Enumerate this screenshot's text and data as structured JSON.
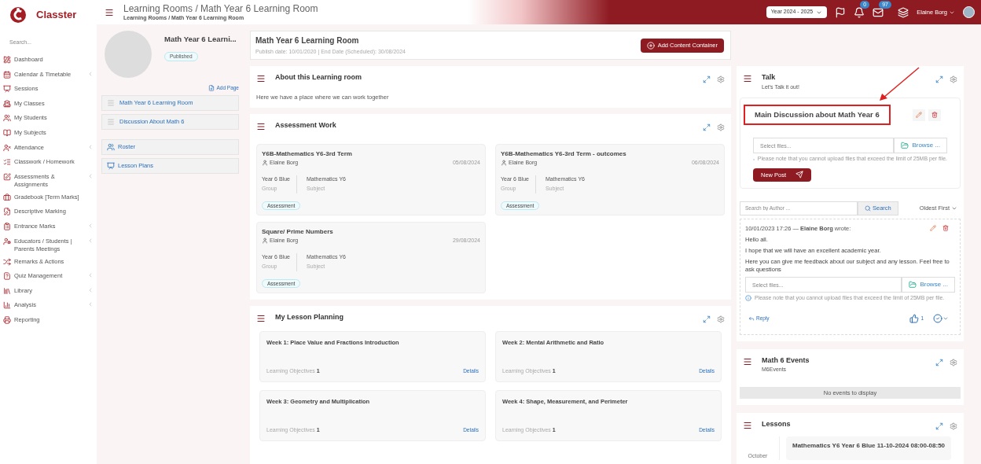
{
  "brand": {
    "name": "Classter"
  },
  "sidebar": {
    "search_placeholder": "Search...",
    "items": [
      {
        "label": "Dashboard",
        "has_submenu": false
      },
      {
        "label": "Calendar & Timetable",
        "has_submenu": true
      },
      {
        "label": "Sessions",
        "has_submenu": false
      },
      {
        "label": "My Classes",
        "has_submenu": false
      },
      {
        "label": "My Students",
        "has_submenu": false
      },
      {
        "label": "My Subjects",
        "has_submenu": false
      },
      {
        "label": "Attendance",
        "has_submenu": true
      },
      {
        "label": "Classwork / Homework",
        "has_submenu": false
      },
      {
        "label": "Assessments & Assignments",
        "has_submenu": true
      },
      {
        "label": "Gradebook [Term Marks]",
        "has_submenu": false
      },
      {
        "label": "Descriptive Marking",
        "has_submenu": false
      },
      {
        "label": "Entrance Marks",
        "has_submenu": true
      },
      {
        "label": "Educators / Students | Parents Meetings",
        "has_submenu": true
      },
      {
        "label": "Remarks & Actions",
        "has_submenu": false
      },
      {
        "label": "Quiz Management",
        "has_submenu": true
      },
      {
        "label": "Library",
        "has_submenu": true
      },
      {
        "label": "Analysis",
        "has_submenu": true
      },
      {
        "label": "Reporting",
        "has_submenu": false
      }
    ]
  },
  "header": {
    "title": "Learning Rooms / Math Year 6 Learning Room",
    "breadcrumb": "Learning Rooms / Math Year 6 Learning Room",
    "year": "Year 2024 - 2025",
    "notifications": "0",
    "messages": "97",
    "user": "Elaine Borg"
  },
  "room_panel": {
    "title": "Math Year 6 Learni...",
    "status": "Published",
    "add_page": "Add Page",
    "pages": [
      {
        "label": "Math Year 6 Learning Room"
      },
      {
        "label": "Discussion About Math 6"
      }
    ],
    "links": [
      {
        "label": "Roster",
        "kind": "roster"
      },
      {
        "label": "Lesson Plans",
        "kind": "plans"
      }
    ]
  },
  "room": {
    "title": "Math Year 6 Learning Room",
    "dates": "Publish date: 10/01/2020 | End Date (Scheduled): 30/08/2024",
    "add_button": "Add Content Container"
  },
  "about": {
    "title": "About this Learning room",
    "text": "Here we have a place where we can work together"
  },
  "assessment_work": {
    "title": "Assessment Work",
    "cards": [
      {
        "title": "Y6B-Mathematics Y6-3rd Term",
        "author": "Elaine Borg",
        "date": "05/08/2024",
        "group": "Year 6 Blue",
        "group_label": "Group",
        "subject": "Mathematics Y6",
        "subject_label": "Subject",
        "tag": "Assessment"
      },
      {
        "title": "Y6B-Mathematics Y6-3rd Term - outcomes",
        "author": "Elaine Borg",
        "date": "06/08/2024",
        "group": "Year 6 Blue",
        "group_label": "Group",
        "subject": "Mathematics Y6",
        "subject_label": "Subject",
        "tag": "Assessment"
      },
      {
        "title": "Square/ Prime Numbers",
        "author": "Elaine Borg",
        "date": "29/08/2024",
        "group": "Year 6 Blue",
        "group_label": "Group",
        "subject": "Mathematics Y6",
        "subject_label": "Subject",
        "tag": "Assessment"
      }
    ]
  },
  "lesson_planning": {
    "title": "My Lesson Planning",
    "weeks": [
      {
        "title": "Week 1: Place Value and Fractions Introduction",
        "objectives_label": "Learning Objectives",
        "objectives": "1",
        "link": "Details"
      },
      {
        "title": "Week 2: Mental Arithmetic and Ratio",
        "objectives_label": "Learning Objectives",
        "objectives": "1",
        "link": "Details"
      },
      {
        "title": "Week 3: Geometry and Multiplication",
        "objectives_label": "Learning Objectives",
        "objectives": "1",
        "link": "Details"
      },
      {
        "title": "Week 4: Shape, Measurement, and Perimeter",
        "objectives_label": "Learning Objectives",
        "objectives": "1",
        "link": "Details"
      }
    ]
  },
  "talk": {
    "title": "Talk",
    "subtitle": "Let's Talk it out!",
    "discussion_title": "Main Discussion about Math Year 6",
    "file_placeholder": "Select files...",
    "browse": "Browse ...",
    "file_note": "Please note that you cannot upload files that exceed the limit of 25MB per file.",
    "new_post": "New Post",
    "search_placeholder": "Search by Author ...",
    "search_button": "Search",
    "sort": "Oldest First",
    "post": {
      "meta": "10/01/2023 17:26 — **Elaine Borg** wrote:",
      "lines": [
        "Hello all.",
        "I hope that we will have an excellent academic year.",
        "Here you can give me feedback about our subject and any lesson. Feel free to ask questions"
      ],
      "file_placeholder": "Select files...",
      "browse": "Browse ...",
      "file_note": "Please note that you cannot upload files that exceed the limit of 25MB per file.",
      "reply": "Reply",
      "likes": "1"
    }
  },
  "events": {
    "title": "Math 6 Events",
    "subtitle": "M6Events",
    "empty": "No events to display"
  },
  "lessons": {
    "title": "Lessons",
    "month": "October",
    "item": "Mathematics Y6 Year 6 Blue 11-10-2024 08:00-08:50"
  }
}
